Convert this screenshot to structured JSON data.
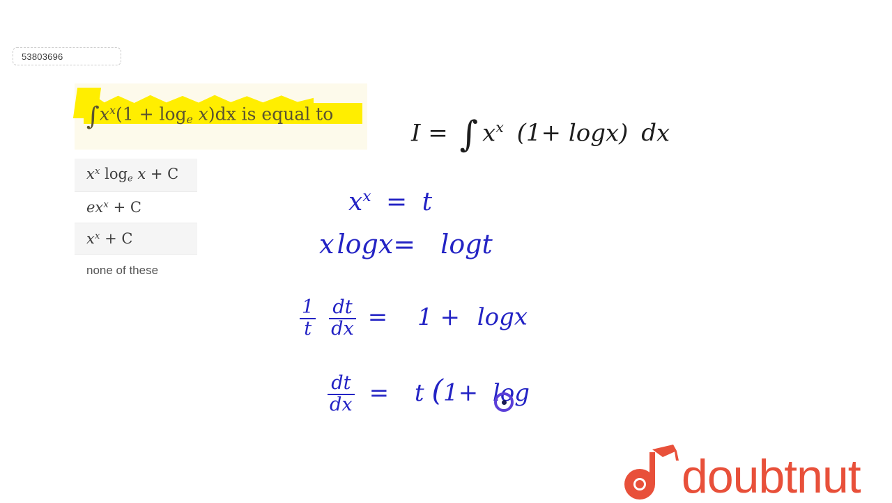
{
  "id_chip": {
    "value": "53803696"
  },
  "question": {
    "full_text": "∫x^x(1 + log_e x)dx is equal to",
    "integral": "∫",
    "base": "x",
    "exponent": "x",
    "open_paren": "(1 + log",
    "log_base": "e",
    "var2": "x",
    "tail": ")dx is equal to",
    "highlight_color": "#ffee00",
    "panel_color": "#fdfaeb"
  },
  "options": [
    {
      "main1": "x",
      "sup1": "x",
      "log": "log",
      "logsub": "e",
      "var": "x",
      "tail": "+ C",
      "kind": "math-log",
      "shaded": true
    },
    {
      "lead": "ex",
      "sup1": "x",
      "tail": "+ C",
      "kind": "math-simple",
      "shaded": false
    },
    {
      "lead": "x",
      "sup1": "x",
      "tail": "+ C",
      "kind": "math-simple",
      "shaded": true
    },
    {
      "text": "none of these",
      "kind": "text",
      "shaded": false
    }
  ],
  "solution": {
    "ink_dark": "#1d1d1d",
    "ink_blue": "#2323c4",
    "lines": [
      {
        "id": "line1",
        "text": "I = ∫ x^x (1+ log x) dx",
        "color": "dark"
      },
      {
        "id": "line2",
        "text": "x^x = t",
        "color": "blue"
      },
      {
        "id": "line3",
        "text": "x log x = log t",
        "color": "blue"
      },
      {
        "id": "line4",
        "text": "1/t dt/dx = 1 + log x",
        "color": "blue"
      },
      {
        "id": "line5",
        "text": "dt/dx = t(1+ log",
        "color": "blue"
      }
    ],
    "l1": {
      "lhs": "I",
      "eq": "=",
      "int": "∫",
      "base": "x",
      "sup": "x",
      "mid": "(1+",
      "log": "log",
      "var": "x",
      "close": ")",
      "d": "d",
      "dvar": "x"
    },
    "l2": {
      "base": "x",
      "sup": "x",
      "eq": "=",
      "rhs": "t"
    },
    "l3": {
      "lhs1": "x",
      "log1": "log",
      "var1": "x",
      "eq": "=",
      "log2": "log",
      "var2": "t"
    },
    "l4": {
      "f1num": "1",
      "f1den": "t",
      "f2num": "dt",
      "f2den": "dx",
      "eq": "=",
      "one": "1 +",
      "log": "log",
      "var": "x"
    },
    "l5": {
      "fnum": "dt",
      "fden": "dx",
      "eq": "=",
      "t": "t",
      "paren": "(",
      "one": "1+",
      "log": "log"
    }
  },
  "pen_cursor": {
    "name": "pen-position-marker",
    "ring_color": "#5b3fd8"
  },
  "logo": {
    "text": "doubtnut",
    "color": "#e8503a",
    "mark": "doubtnut-d-with-graduation-cap"
  }
}
